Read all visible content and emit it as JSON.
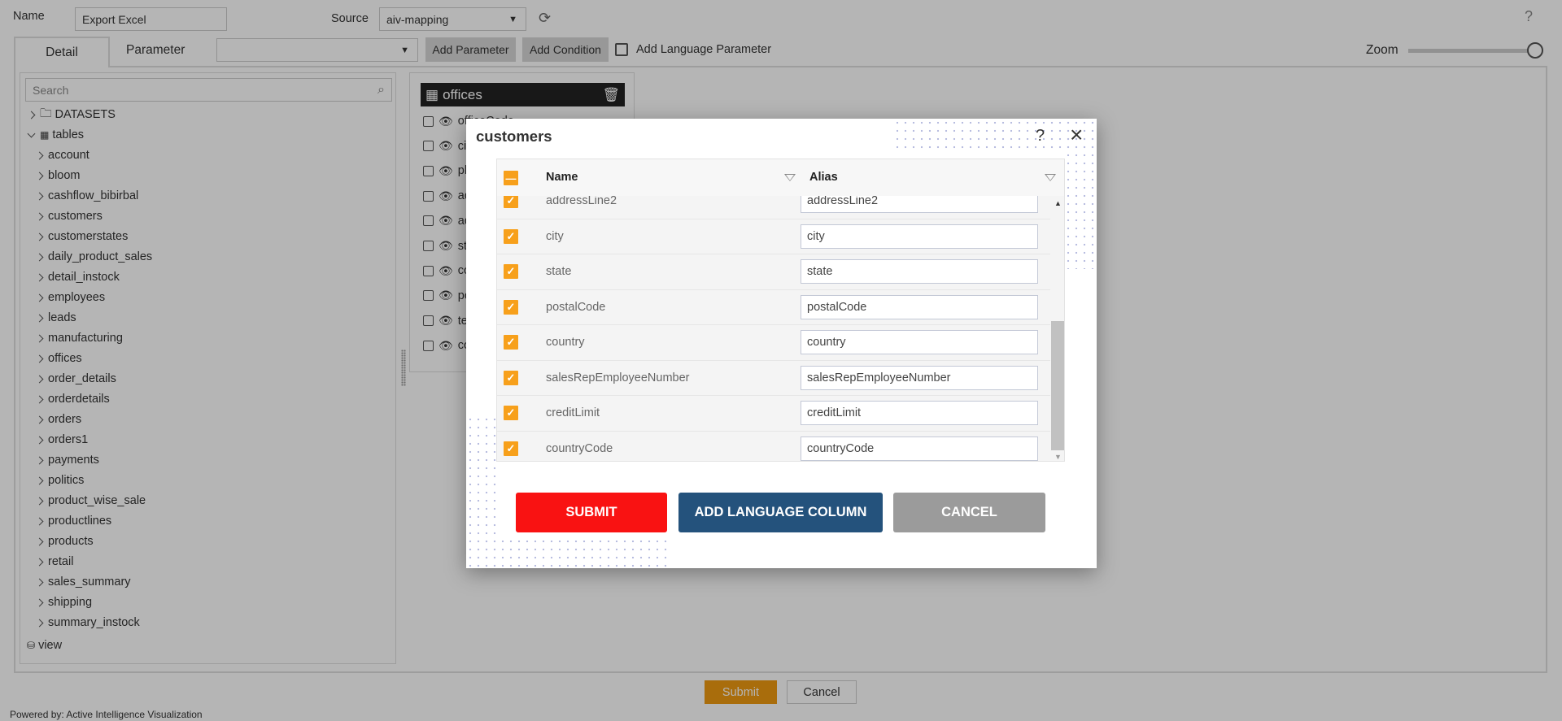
{
  "header": {
    "name_label": "Name",
    "name_value": "Export Excel",
    "source_label": "Source",
    "source_value": "aiv-mapping",
    "help": "?"
  },
  "tabs": [
    {
      "label": "Detail",
      "active": true
    },
    {
      "label": "Parameter",
      "active": false
    }
  ],
  "toolbar": {
    "parameter_select": "",
    "add_parameter": "Add Parameter",
    "add_condition": "Add Condition",
    "add_language_parameter": "Add Language Parameter",
    "zoom_label": "Zoom",
    "zoom_level": 100
  },
  "tree": {
    "search_placeholder": "Search",
    "datasets": "DATASETS",
    "tables": "tables",
    "items": [
      "account",
      "bloom",
      "cashflow_bibirbal",
      "customers",
      "customerstates",
      "daily_product_sales",
      "detail_instock",
      "employees",
      "leads",
      "manufacturing",
      "offices",
      "order_details",
      "orderdetails",
      "orders",
      "orders1",
      "payments",
      "politics",
      "product_wise_sale",
      "productlines",
      "products",
      "retail",
      "sales_summary",
      "shipping",
      "summary_instock"
    ],
    "view": "view"
  },
  "offices": {
    "title": "offices",
    "fields": [
      "officeCode",
      "ci",
      "ph",
      "ad",
      "ad",
      "st",
      "co",
      "po",
      "te",
      "co"
    ]
  },
  "footer": {
    "submit": "Submit",
    "cancel": "Cancel",
    "powered_by": "Powered by: Active Intelligence Visualization"
  },
  "dialog": {
    "title": "customers",
    "help": "?",
    "close": "×",
    "columns": {
      "name": "Name",
      "alias": "Alias"
    },
    "rows": [
      {
        "name": "addressLine2",
        "alias": "addressLine2"
      },
      {
        "name": "city",
        "alias": "city"
      },
      {
        "name": "state",
        "alias": "state"
      },
      {
        "name": "postalCode",
        "alias": "postalCode"
      },
      {
        "name": "country",
        "alias": "country"
      },
      {
        "name": "salesRepEmployeeNumber",
        "alias": "salesRepEmployeeNumber"
      },
      {
        "name": "creditLimit",
        "alias": "creditLimit"
      },
      {
        "name": "countryCode",
        "alias": "countryCode"
      }
    ],
    "submit": "SUBMIT",
    "add_language_column": "ADD LANGUAGE COLUMN",
    "cancel": "CANCEL"
  },
  "colors": {
    "accent": "#f7a01b",
    "submit": "#f91212",
    "language": "#24527c",
    "cancel": "#9b9b9b",
    "footer_submit": "#ee9a12"
  }
}
